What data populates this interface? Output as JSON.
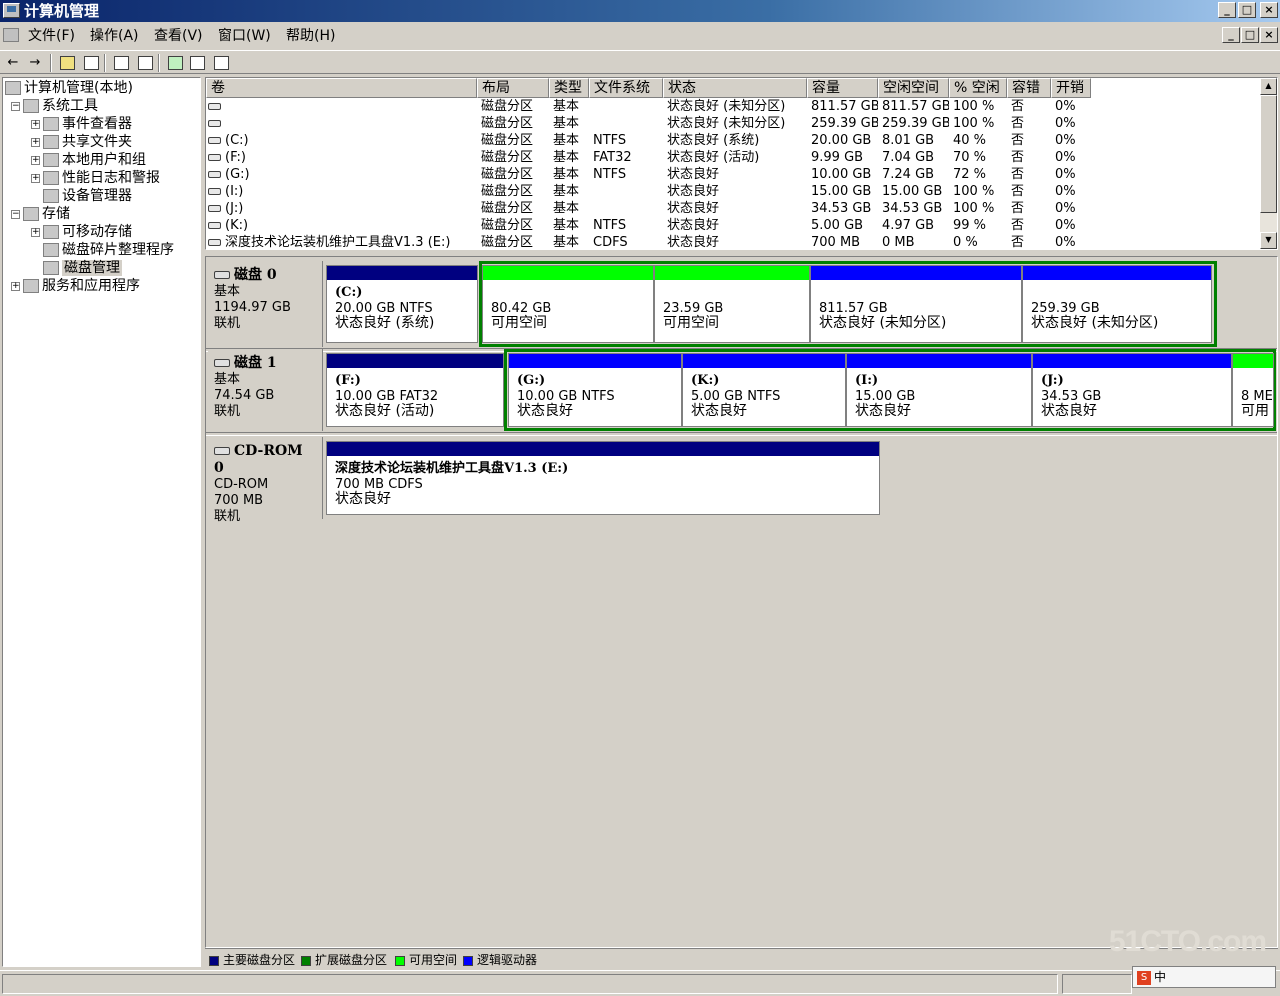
{
  "window": {
    "title": "计算机管理",
    "min": "_",
    "max": "□",
    "close": "×"
  },
  "menu": [
    "文件(F)",
    "操作(A)",
    "查看(V)",
    "窗口(W)",
    "帮助(H)"
  ],
  "tree": [
    {
      "label": "计算机管理(本地)",
      "level": 0,
      "expander": ""
    },
    {
      "label": "系统工具",
      "level": 1,
      "expander": "−"
    },
    {
      "label": "事件查看器",
      "level": 2,
      "expander": "+"
    },
    {
      "label": "共享文件夹",
      "level": 2,
      "expander": "+"
    },
    {
      "label": "本地用户和组",
      "level": 2,
      "expander": "+"
    },
    {
      "label": "性能日志和警报",
      "level": 2,
      "expander": "+"
    },
    {
      "label": "设备管理器",
      "level": 2,
      "expander": ""
    },
    {
      "label": "存储",
      "level": 1,
      "expander": "−"
    },
    {
      "label": "可移动存储",
      "level": 2,
      "expander": "+"
    },
    {
      "label": "磁盘碎片整理程序",
      "level": 2,
      "expander": ""
    },
    {
      "label": "磁盘管理",
      "level": 2,
      "expander": "",
      "selected": true
    },
    {
      "label": "服务和应用程序",
      "level": 1,
      "expander": "+"
    }
  ],
  "columns": [
    "卷",
    "布局",
    "类型",
    "文件系统",
    "状态",
    "容量",
    "空闲空间",
    "% 空闲",
    "容错",
    "开销"
  ],
  "volumes": [
    [
      "",
      "磁盘分区",
      "基本",
      "",
      "状态良好 (未知分区)",
      "811.57 GB",
      "811.57 GB",
      "100 %",
      "否",
      "0%"
    ],
    [
      "",
      "磁盘分区",
      "基本",
      "",
      "状态良好 (未知分区)",
      "259.39 GB",
      "259.39 GB",
      "100 %",
      "否",
      "0%"
    ],
    [
      "(C:)",
      "磁盘分区",
      "基本",
      "NTFS",
      "状态良好 (系统)",
      "20.00 GB",
      "8.01 GB",
      "40 %",
      "否",
      "0%"
    ],
    [
      "(F:)",
      "磁盘分区",
      "基本",
      "FAT32",
      "状态良好 (活动)",
      "9.99 GB",
      "7.04 GB",
      "70 %",
      "否",
      "0%"
    ],
    [
      "(G:)",
      "磁盘分区",
      "基本",
      "NTFS",
      "状态良好",
      "10.00 GB",
      "7.24 GB",
      "72 %",
      "否",
      "0%"
    ],
    [
      "(I:)",
      "磁盘分区",
      "基本",
      "",
      "状态良好",
      "15.00 GB",
      "15.00 GB",
      "100 %",
      "否",
      "0%"
    ],
    [
      "(J:)",
      "磁盘分区",
      "基本",
      "",
      "状态良好",
      "34.53 GB",
      "34.53 GB",
      "100 %",
      "否",
      "0%"
    ],
    [
      "(K:)",
      "磁盘分区",
      "基本",
      "NTFS",
      "状态良好",
      "5.00 GB",
      "4.97 GB",
      "99 %",
      "否",
      "0%"
    ],
    [
      "深度技术论坛装机维护工具盘V1.3 (E:)",
      "磁盘分区",
      "基本",
      "CDFS",
      "状态良好",
      "700 MB",
      "0 MB",
      "0 %",
      "否",
      "0%"
    ]
  ],
  "disks": [
    {
      "name": "磁盘 0",
      "type": "基本",
      "size": "1194.97 GB",
      "state": "联机",
      "parts": [
        {
          "name": "(C:)",
          "l1": "20.00 GB NTFS",
          "l2": "状态良好 (系统)",
          "bar": "#000080"
        },
        {
          "name": "",
          "l1": "80.42 GB",
          "l2": "可用空间",
          "bar": "#00ff00"
        },
        {
          "name": "",
          "l1": "23.59 GB",
          "l2": "可用空间",
          "bar": "#00ff00"
        },
        {
          "name": "",
          "l1": "811.57 GB",
          "l2": "状态良好 (未知分区)",
          "bar": "#0000ff"
        },
        {
          "name": "",
          "l1": "259.39 GB",
          "l2": "状态良好 (未知分区)",
          "bar": "#0000ff"
        }
      ]
    },
    {
      "name": "磁盘 1",
      "type": "基本",
      "size": "74.54 GB",
      "state": "联机",
      "parts": [
        {
          "name": "(F:)",
          "l1": "10.00 GB FAT32",
          "l2": "状态良好 (活动)",
          "bar": "#000080"
        },
        {
          "name": "(G:)",
          "l1": "10.00 GB NTFS",
          "l2": "状态良好",
          "bar": "#0000ff"
        },
        {
          "name": "(K:)",
          "l1": "5.00 GB NTFS",
          "l2": "状态良好",
          "bar": "#0000ff"
        },
        {
          "name": "(I:)",
          "l1": "15.00 GB",
          "l2": "状态良好",
          "bar": "#0000ff"
        },
        {
          "name": "(J:)",
          "l1": "34.53 GB",
          "l2": "状态良好",
          "bar": "#0000ff"
        },
        {
          "name": "",
          "l1": "8 ME",
          "l2": "可用",
          "bar": "#00ff00"
        }
      ]
    },
    {
      "name": "CD-ROM 0",
      "type": "CD-ROM",
      "size": "700 MB",
      "state": "联机",
      "parts": [
        {
          "name": "深度技术论坛装机维护工具盘V1.3 (E:)",
          "l1": "700 MB CDFS",
          "l2": "状态良好",
          "bar": "#000080"
        }
      ]
    }
  ],
  "legend": [
    {
      "label": "主要磁盘分区",
      "color": "#000080"
    },
    {
      "label": "扩展磁盘分区",
      "color": "#008000"
    },
    {
      "label": "可用空间",
      "color": "#00ff00"
    },
    {
      "label": "逻辑驱动器",
      "color": "#0000ff"
    }
  ],
  "watermark": "51CTO.com",
  "ime_text": "中"
}
